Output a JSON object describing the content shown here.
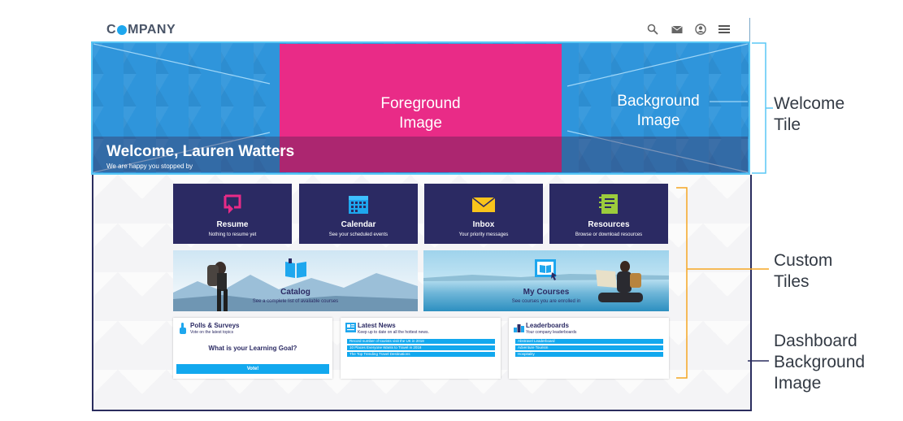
{
  "header": {
    "logo_prefix": "C",
    "logo_suffix": "MPANY",
    "icons": [
      "search-icon",
      "mail-icon",
      "user-icon",
      "menu-icon"
    ]
  },
  "welcome": {
    "foreground_label_1": "Foreground",
    "foreground_label_2": "Image",
    "background_label_1": "Background",
    "background_label_2": "Image",
    "title": "Welcome, Lauren Watters",
    "subtitle": "We are happy you stopped by"
  },
  "tiles": [
    {
      "title": "Resume",
      "subtitle": "Nothing to resume yet",
      "icon": "resume-icon"
    },
    {
      "title": "Calendar",
      "subtitle": "See your scheduled events",
      "icon": "calendar-icon"
    },
    {
      "title": "Inbox",
      "subtitle": "Your priority messages",
      "icon": "envelope-icon"
    },
    {
      "title": "Resources",
      "subtitle": "Browse or download resources",
      "icon": "notebook-icon"
    }
  ],
  "photo_tiles": [
    {
      "title": "Catalog",
      "subtitle": "See a complete list of available courses",
      "icon": "book-icon"
    },
    {
      "title": "My Courses",
      "subtitle": "See courses you are enrolled in",
      "icon": "course-icon"
    }
  ],
  "polls": {
    "title": "Polls & Surveys",
    "subtitle": "Vote on the latest topics",
    "question": "What is your Learning Goal?",
    "button": "Vote!"
  },
  "news": {
    "title": "Latest News",
    "subtitle": "Keep up to date on all the hottest news.",
    "items": [
      "Record number of tourists visit the UK in 2018",
      "10 Places Everyone Wants to Travel in 2018",
      "The Top Trending Travel Destinations"
    ]
  },
  "leaderboards": {
    "title": "Leaderboards",
    "subtitle": "Your company leaderboards",
    "items": [
      "Abstravel Leaderboard",
      "Adventure Tourism",
      "Hospitality"
    ]
  },
  "annotations": {
    "welcome_1": "Welcome",
    "welcome_2": "Tile",
    "custom_1": "Custom",
    "custom_2": "Tiles",
    "dash_1": "Dashboard",
    "dash_2": "Background",
    "dash_3": "Image"
  },
  "colors": {
    "welcome_blue": "#2f95db",
    "foreground_pink": "#e92b87",
    "tile_navy": "#2b2a63",
    "accent_cyan": "#12a8ee",
    "bracket_blue": "#59c7f5",
    "bracket_orange": "#f5a623",
    "bracket_navy": "#2a2d5e"
  }
}
